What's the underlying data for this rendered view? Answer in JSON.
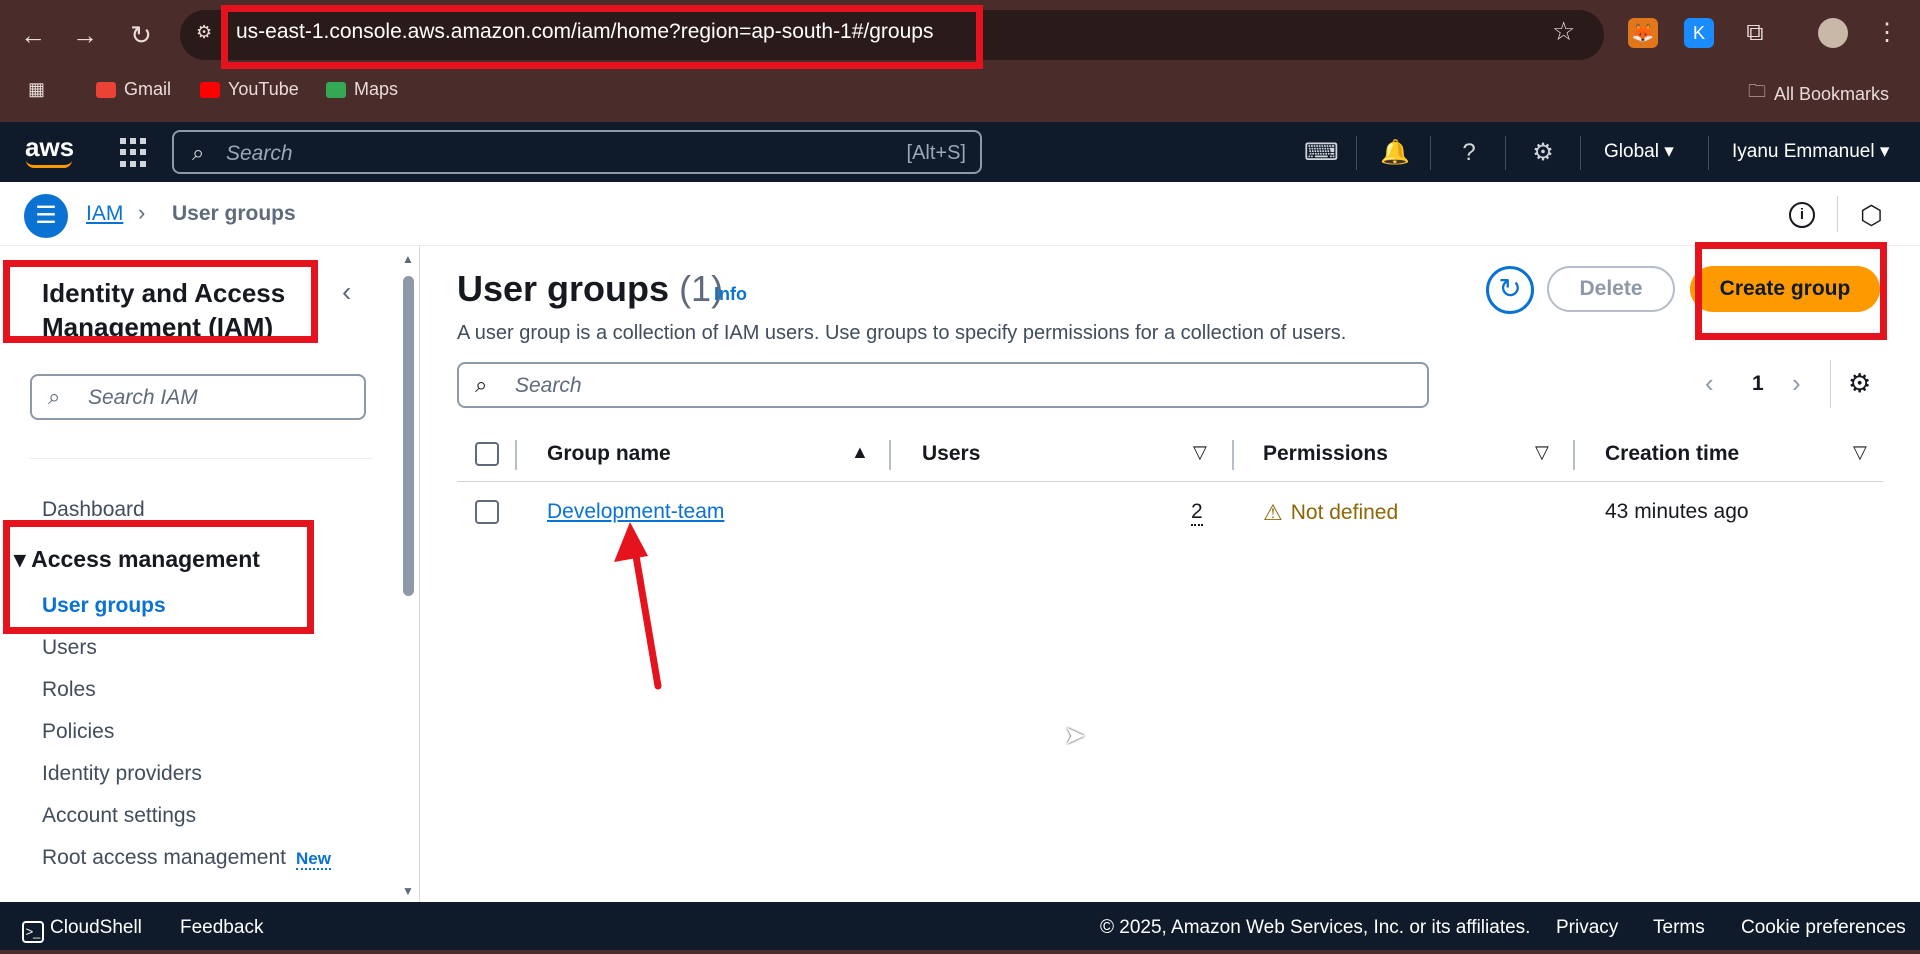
{
  "browser": {
    "url": "us-east-1.console.aws.amazon.com/iam/home?region=ap-south-1#/groups",
    "bookmarks": [
      "Gmail",
      "YouTube",
      "Maps"
    ],
    "all_bookmarks": "All Bookmarks",
    "ext_k": "K"
  },
  "aws_nav": {
    "logo": "aws",
    "search_placeholder": "Search",
    "search_shortcut": "[Alt+S]",
    "region": "Global",
    "user": "Iyanu Emmanuel"
  },
  "breadcrumb": {
    "root": "IAM",
    "current": "User groups",
    "info_glyph": "i"
  },
  "sidebar": {
    "title": "Identity and Access Management (IAM)",
    "search_placeholder": "Search IAM",
    "dashboard": "Dashboard",
    "section": "Access management",
    "items": [
      "User groups",
      "Users",
      "Roles",
      "Policies",
      "Identity providers",
      "Account settings",
      "Root access management"
    ],
    "new_badge": "New"
  },
  "main": {
    "title": "User groups",
    "count": "(1)",
    "info": "Info",
    "description": "A user group is a collection of IAM users. Use groups to specify permissions for a collection of users.",
    "delete_label": "Delete",
    "create_label": "Create group",
    "search_placeholder": "Search",
    "page": "1",
    "columns": [
      "Group name",
      "Users",
      "Permissions",
      "Creation time"
    ],
    "rows": [
      {
        "group_name": "Development-team",
        "users": "2",
        "permissions": "Not defined",
        "creation_time": "43 minutes ago"
      }
    ]
  },
  "footer": {
    "cloudshell": "CloudShell",
    "feedback": "Feedback",
    "copyright": "© 2025, Amazon Web Services, Inc. or its affiliates.",
    "privacy": "Privacy",
    "terms": "Terms",
    "cookies": "Cookie preferences"
  },
  "colors": {
    "accent": "#0972d3",
    "primary_button": "#ff9900",
    "warning": "#8d6605",
    "annotation": "#e4131d"
  }
}
